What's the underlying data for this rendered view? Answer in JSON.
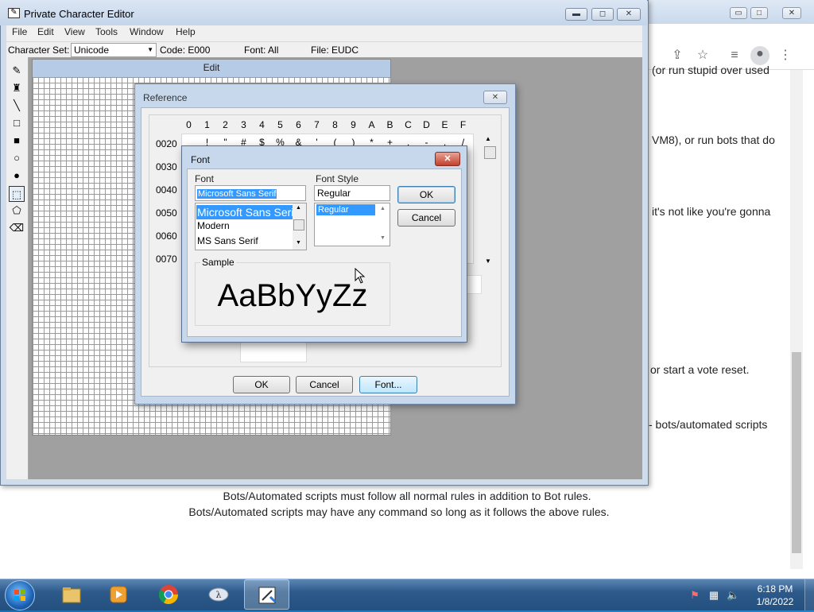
{
  "chrome": {
    "window_controls": [
      "▭",
      "□",
      "✕"
    ],
    "toolbar_icons": [
      "share-icon",
      "star-icon",
      "playlist-icon",
      "profile-icon",
      "kebab-menu-icon"
    ],
    "page_fragments": [
      "(or run stupid over used",
      "VM8), or run bots that do",
      "it's not like you're gonna",
      "or start a vote reset.",
      "- bots/automated scripts"
    ],
    "page_lines": [
      "Bots/Automated scripts must follow all normal rules in addition to Bot rules.",
      "Bots/Automated scripts may have any command so long as it follows the above rules."
    ]
  },
  "editor": {
    "title": "Private Character Editor",
    "menus": [
      "File",
      "Edit",
      "View",
      "Tools",
      "Window",
      "Help"
    ],
    "charset_label": "Character Set:",
    "charset_value": "Unicode",
    "code": "Code: E000",
    "font": "Font: All",
    "file": "File: EUDC",
    "edit_header": "Edit",
    "tools": [
      "pencil-icon",
      "brush-icon",
      "line-icon",
      "hollow-rectangle-icon",
      "filled-rectangle-icon",
      "hollow-ellipse-icon",
      "filled-ellipse-icon",
      "rectangular-selection-icon",
      "freeform-selection-icon",
      "eraser-icon"
    ]
  },
  "reference": {
    "title": "Reference",
    "columns": [
      "0",
      "1",
      "2",
      "3",
      "4",
      "5",
      "6",
      "7",
      "8",
      "9",
      "A",
      "B",
      "C",
      "D",
      "E",
      "F"
    ],
    "rows": [
      "0020",
      "0030",
      "0040",
      "0050",
      "0060",
      "0070"
    ],
    "row0_glyphs": [
      "",
      "!",
      "\"",
      "#",
      "$",
      "%",
      "&",
      "'",
      "(",
      ")",
      "*",
      "+",
      ",",
      "-",
      ".",
      "/"
    ],
    "buttons": {
      "ok": "OK",
      "cancel": "Cancel",
      "font": "Font..."
    }
  },
  "font_dialog": {
    "title": "Font",
    "font_label": "Font",
    "font_value": "Microsoft Sans Serif",
    "font_list": [
      "Microsoft Sans Serif",
      "Modern",
      "MS Sans Serif"
    ],
    "style_label": "Font Style",
    "style_value": "Regular",
    "style_list": [
      "Regular"
    ],
    "ok": "OK",
    "cancel": "Cancel",
    "sample_label": "Sample",
    "sample_text": "AaBbYyZz"
  },
  "taskbar": {
    "items": [
      "file-explorer-icon",
      "media-player-icon",
      "chrome-icon",
      "ime-pad-icon",
      "private-character-editor-icon"
    ],
    "active_index": 4,
    "time": "6:18 PM",
    "date": "1/8/2022"
  }
}
